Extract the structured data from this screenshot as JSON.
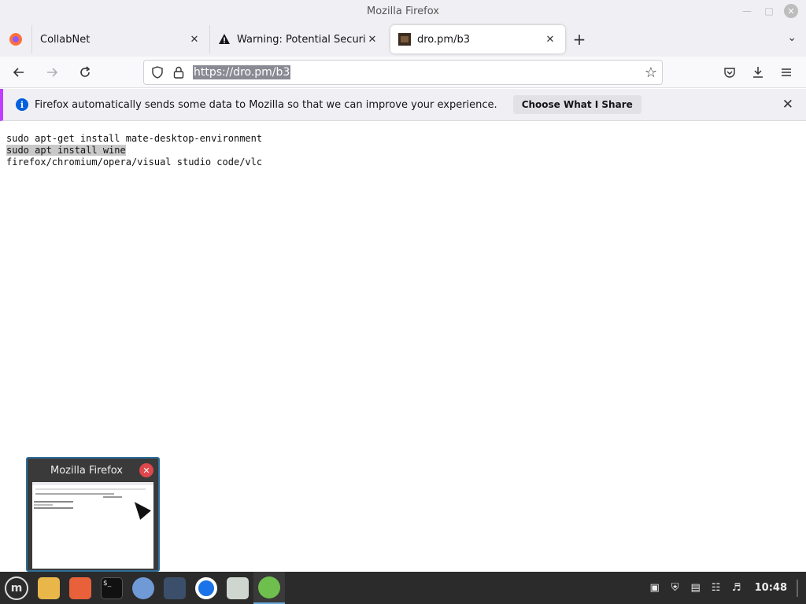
{
  "window": {
    "title": "Mozilla Firefox"
  },
  "tabs": [
    {
      "label": "CollabNet",
      "icon": "collabnet-icon"
    },
    {
      "label": "Warning: Potential Security Risk Ahead",
      "icon": "warning-icon"
    },
    {
      "label": "dro.pm/b3",
      "icon": "site-favicon",
      "active": true
    }
  ],
  "navbar": {
    "url": "https://dro.pm/b3"
  },
  "notification": {
    "message": "Firefox automatically sends some data to Mozilla so that we can improve your experience.",
    "button": "Choose What I Share"
  },
  "content": {
    "lines": [
      "sudo apt-get install mate-desktop-environment",
      "sudo apt install wine",
      "firefox/chromium/opera/visual studio code/vlc"
    ]
  },
  "preview": {
    "title": "Mozilla Firefox"
  },
  "taskbar": {
    "apps": [
      "files-icon",
      "firefox-icon",
      "terminal-icon",
      "chromium-icon",
      "chess-icon",
      "chrome-icon",
      "settings-icon",
      "calculator-icon"
    ],
    "clock": "10:48"
  },
  "colors": {
    "accent": "#0060df",
    "notification_border": "#c13eff",
    "taskbar": "#2b2b2b"
  }
}
